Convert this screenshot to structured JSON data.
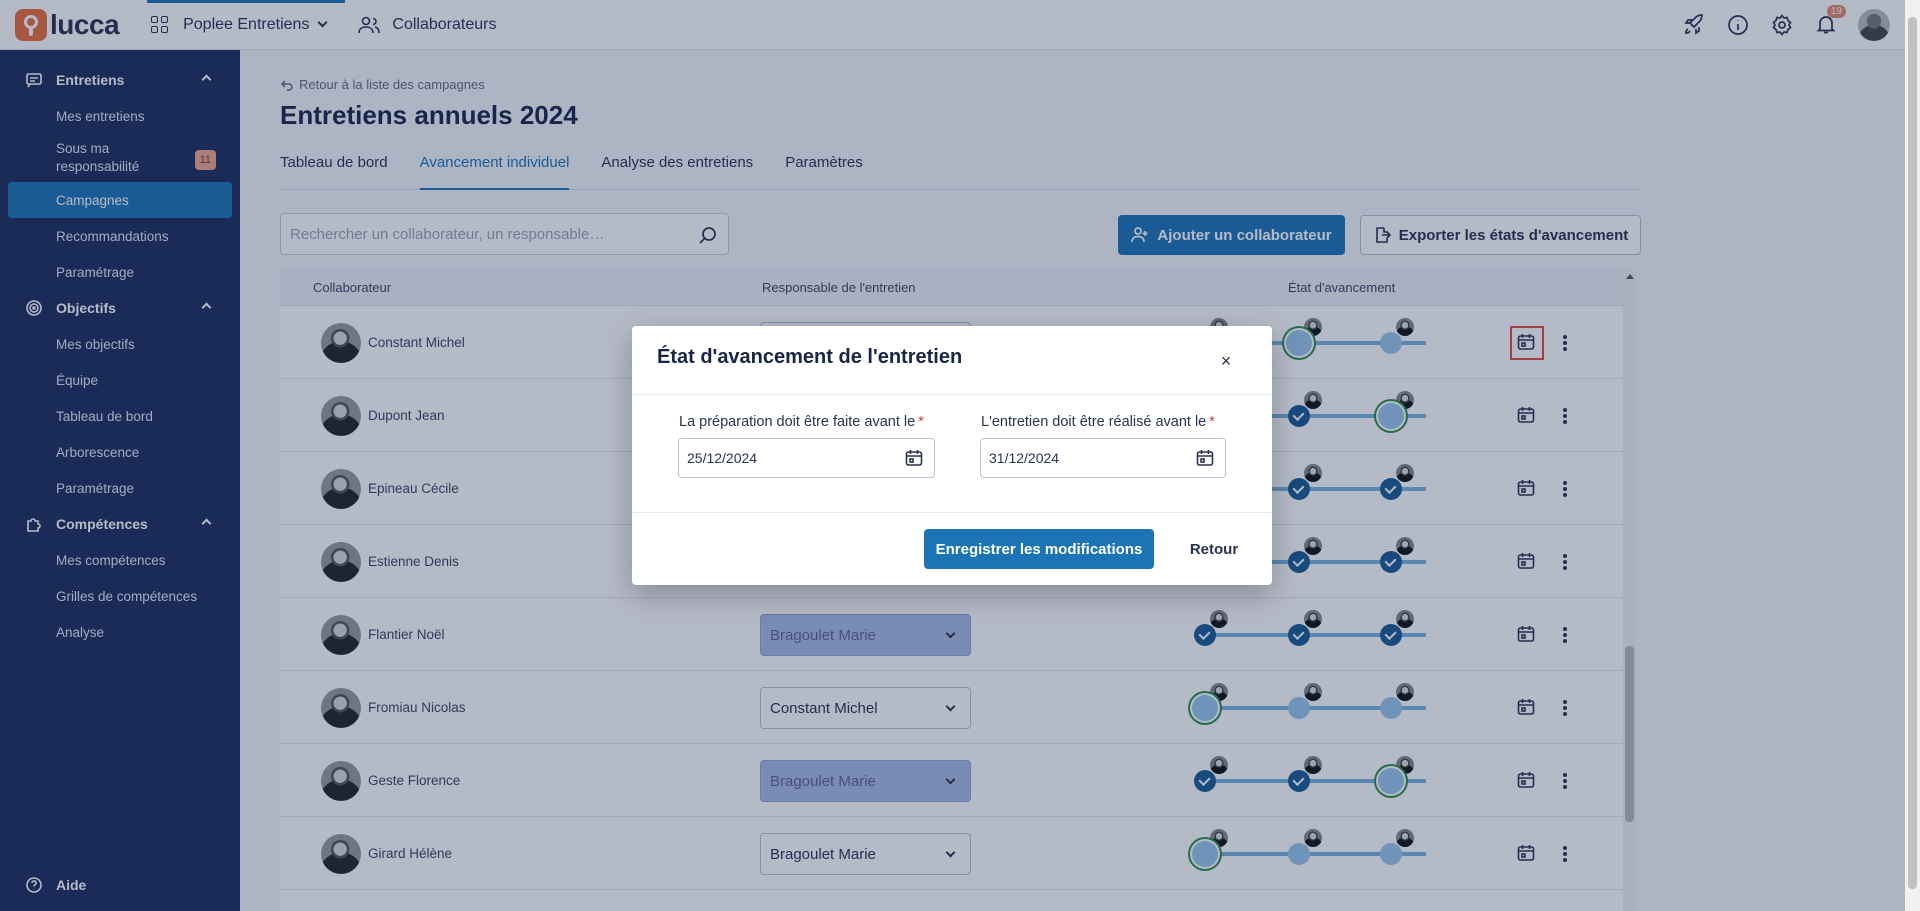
{
  "topbar": {
    "logo_text": "lucca",
    "app_name": "Poplee Entretiens",
    "people_link": "Collaborateurs",
    "notifications_count": "19",
    "icons": [
      "rocket-icon",
      "info-icon",
      "gear-icon",
      "bell-icon"
    ]
  },
  "sidebar": {
    "sections": [
      {
        "label": "Entretiens",
        "icon": "chat-icon"
      },
      {
        "label": "Objectifs",
        "icon": "target-icon"
      },
      {
        "label": "Compétences",
        "icon": "puzzle-icon"
      }
    ],
    "entretiens_items": [
      "Mes entretiens",
      "Sous ma responsabilité",
      "Campagnes",
      "Recommandations",
      "Paramétrage"
    ],
    "sous_ma_resp_badge": "11",
    "objectifs_items": [
      "Mes objectifs",
      "Équipe",
      "Tableau de bord",
      "Arborescence",
      "Paramétrage"
    ],
    "competences_items": [
      "Mes compétences",
      "Grilles de compétences",
      "Analyse"
    ],
    "help": "Aide"
  },
  "page": {
    "back_link": "Retour à la liste des campagnes",
    "title": "Entretiens annuels 2024",
    "tabs": [
      "Tableau de bord",
      "Avancement individuel",
      "Analyse des entretiens",
      "Paramètres"
    ],
    "search_placeholder": "Rechercher un collaborateur, un responsable…",
    "add_button": "Ajouter un collaborateur",
    "export_button": "Exporter les états d'avancement"
  },
  "table": {
    "headers": [
      "Collaborateur",
      "Responsable de l'entretien",
      "État d'avancement"
    ],
    "rows": [
      {
        "name": "Constant Michel",
        "manager": "",
        "manager_disabled": false
      },
      {
        "name": "Dupont Jean",
        "manager": "",
        "manager_disabled": false
      },
      {
        "name": "Epineau Cécile",
        "manager": "",
        "manager_disabled": false
      },
      {
        "name": "Estienne Denis",
        "manager": "",
        "manager_disabled": false
      },
      {
        "name": "Flantier Noël",
        "manager": "Bragoulet Marie",
        "manager_disabled": true
      },
      {
        "name": "Fromiau Nicolas",
        "manager": "Constant Michel",
        "manager_disabled": false
      },
      {
        "name": "Geste Florence",
        "manager": "Bragoulet Marie",
        "manager_disabled": true
      },
      {
        "name": "Girard Hélène",
        "manager": "Bragoulet Marie",
        "manager_disabled": false
      }
    ]
  },
  "modal": {
    "title": "État d'avancement de l'entretien",
    "close": "×",
    "field1_label": "La préparation doit être faite avant le",
    "field1_value": "25/12/2024",
    "field2_label": "L'entretien doit être réalisé avant le",
    "field2_value": "31/12/2024",
    "required_mark": "*",
    "save_button": "Enregistrer les modifications",
    "back_button": "Retour"
  },
  "colors": {
    "primary": "#1c74b5",
    "sidebar": "#1c2d5a",
    "done": "#1a5a92",
    "current_ring": "#2a8c4a",
    "highlight": "#e24a4a"
  }
}
